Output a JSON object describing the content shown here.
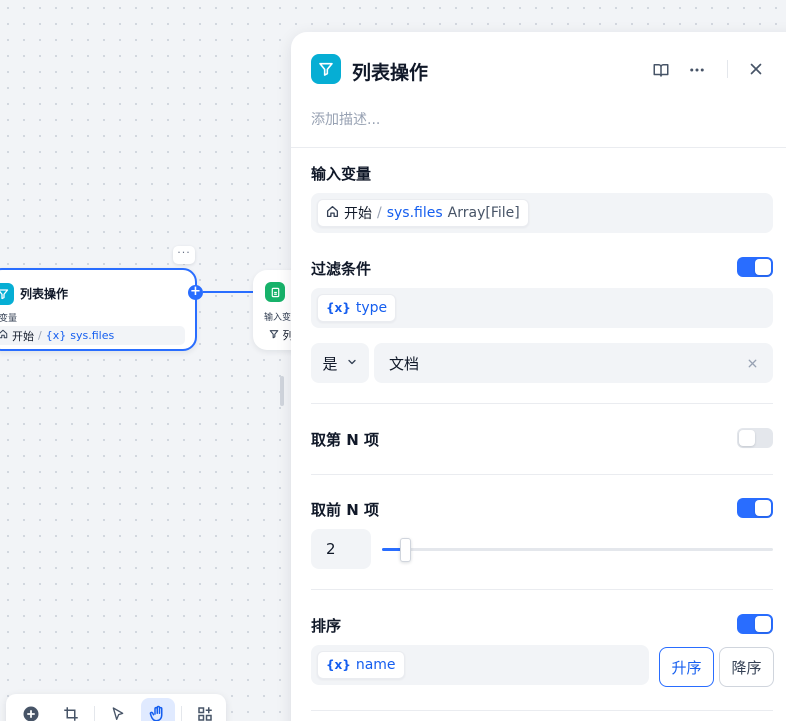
{
  "canvas": {
    "list_node": {
      "title": "列表操作",
      "input_label": "入变量",
      "var_source": "开始",
      "var_sep": "/",
      "var_badge": "{x}",
      "var_name": "sys.files"
    },
    "next_node": {
      "input_label": "输入变",
      "var_prefix": "列"
    },
    "toolbar": {
      "tools": [
        "add-node",
        "organize",
        "pointer",
        "hand",
        "more"
      ],
      "active": "hand"
    }
  },
  "panel": {
    "title": "列表操作",
    "description_placeholder": "添加描述...",
    "input": {
      "label": "输入变量",
      "source": "开始",
      "sep": "/",
      "var_name": "sys.files",
      "var_type": "Array[File]"
    },
    "filter": {
      "label": "过滤条件",
      "enabled": true,
      "var_badge": "{x}",
      "var_name": "type",
      "operator": "是",
      "value": "文档"
    },
    "nth": {
      "label": "取第 N 项",
      "enabled": false
    },
    "first_n": {
      "label": "取前 N 项",
      "enabled": true,
      "value": "2",
      "slider_fraction": 0.06
    },
    "sort": {
      "label": "排序",
      "enabled": true,
      "var_badge": "{x}",
      "var_name": "name",
      "asc_label": "升序",
      "desc_label": "降序",
      "selected": "asc"
    }
  },
  "colors": {
    "accent": "#296dff",
    "node_icon": "#06aed4",
    "next_node_icon": "#17b26a"
  }
}
